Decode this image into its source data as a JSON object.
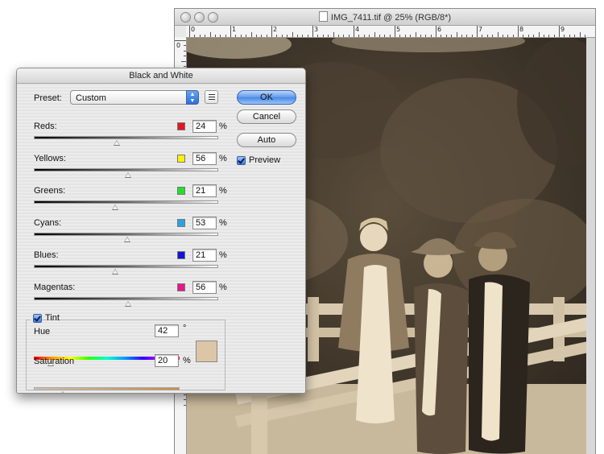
{
  "document": {
    "title": "IMG_7411.tif @ 25% (RGB/8*)",
    "ruler_top_labels": [
      "0",
      "1",
      "2",
      "3",
      "4",
      "5",
      "6",
      "7",
      "8",
      "9"
    ],
    "ruler_left_labels": [
      "0",
      "1",
      "2",
      "3",
      "4",
      "5",
      "6",
      "7",
      "8"
    ]
  },
  "dialog": {
    "title": "Black and White",
    "preset": {
      "label": "Preset:",
      "value": "Custom"
    },
    "channels": [
      {
        "label": "Reds:",
        "value": "24",
        "color": "#e8141e",
        "level": 24
      },
      {
        "label": "Yellows:",
        "value": "56",
        "color": "#fff200",
        "level": 56
      },
      {
        "label": "Greens:",
        "value": "21",
        "color": "#22e12a",
        "level": 21
      },
      {
        "label": "Cyans:",
        "value": "53",
        "color": "#2aa3e0",
        "level": 53
      },
      {
        "label": "Blues:",
        "value": "21",
        "color": "#1414d8",
        "level": 21
      },
      {
        "label": "Magentas:",
        "value": "56",
        "color": "#e8168a",
        "level": 56
      }
    ],
    "percent_sign": "%",
    "degree_sign": "°",
    "buttons": {
      "ok": "OK",
      "cancel": "Cancel",
      "auto": "Auto"
    },
    "preview": {
      "label": "Preview",
      "checked": true
    },
    "tint": {
      "label": "Tint",
      "checked": true,
      "hue_label": "Hue",
      "hue_value": "42",
      "saturation_label": "Saturation",
      "saturation_value": "20",
      "color": "#dcc6a6"
    }
  }
}
